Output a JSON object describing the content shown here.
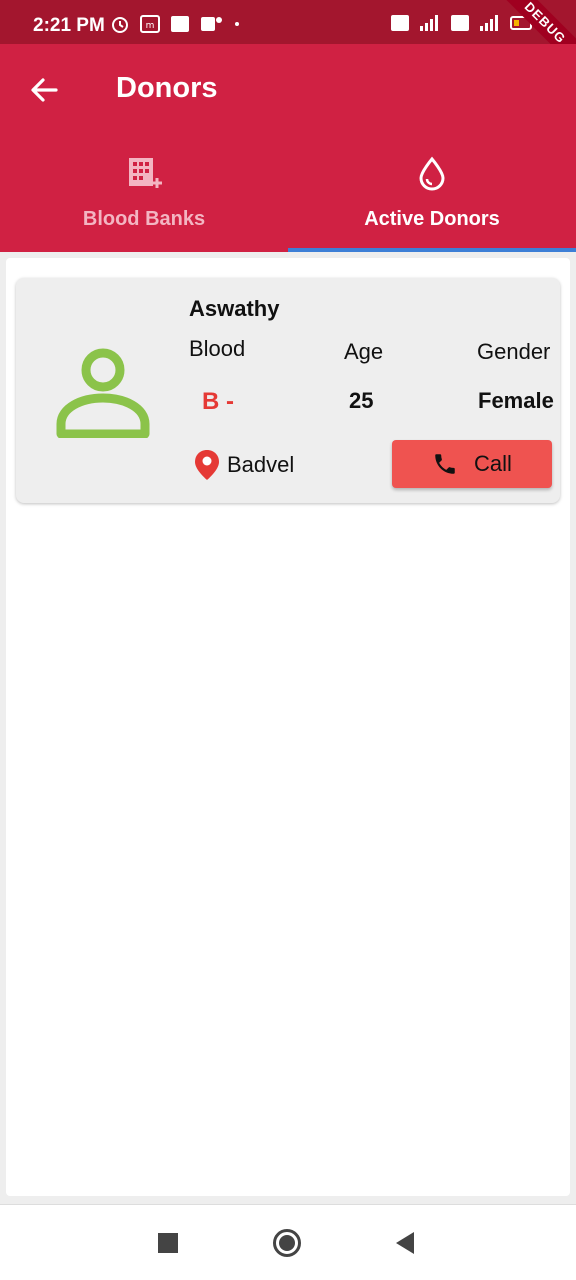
{
  "status_bar": {
    "time": "2:21 PM",
    "debug_label": "DEBUG"
  },
  "app_bar": {
    "title": "Donors",
    "back_icon": "arrow-back-icon"
  },
  "tabs": [
    {
      "label": "Blood Banks",
      "icon": "hospital-icon",
      "selected": false
    },
    {
      "label": "Active Donors",
      "icon": "blood-drop-icon",
      "selected": true
    }
  ],
  "donor": {
    "name": "Aswathy",
    "blood_label": "Blood",
    "age_label": "Age",
    "gender_label": "Gender",
    "blood_group": "B -",
    "age": "25",
    "gender": "Female",
    "location": "Badvel",
    "call_label": "Call"
  },
  "colors": {
    "app_bar": "#d02143",
    "status_bar": "#a3162e",
    "avatar": "#8bc34a",
    "blood_value": "#e53935",
    "call_button": "#ef5350",
    "tab_indicator": "#3d7fd6"
  }
}
